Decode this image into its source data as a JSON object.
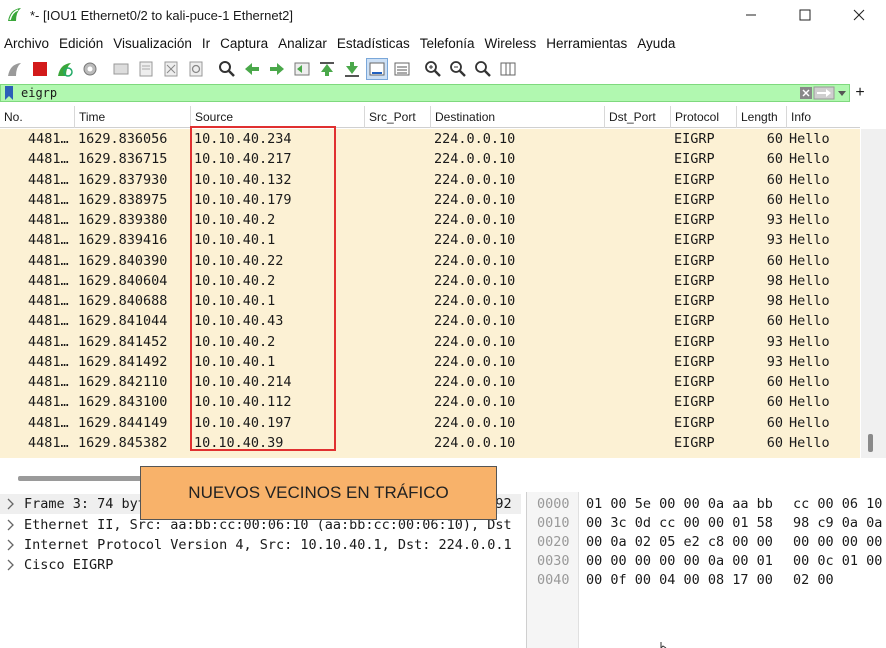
{
  "window": {
    "title": "*- [IOU1 Ethernet0/2 to kali-puce-1 Ethernet2]"
  },
  "menu": [
    "Archivo",
    "Edición",
    "Visualización",
    "Ir",
    "Captura",
    "Analizar",
    "Estadísticas",
    "Telefonía",
    "Wireless",
    "Herramientas",
    "Ayuda"
  ],
  "toolbar_icons": [
    "shark-fin-icon",
    "stop-capture-icon",
    "restart-capture-icon",
    "capture-options-icon",
    "open-file-icon",
    "save-file-icon",
    "close-file-icon",
    "reload-icon",
    "find-packet-icon",
    "go-back-icon",
    "go-forward-icon",
    "go-to-packet-icon",
    "go-first-icon",
    "go-last-icon",
    "autoscroll-icon",
    "colorize-icon",
    "zoom-in-icon",
    "zoom-out-icon",
    "zoom-normal-icon",
    "resize-columns-icon"
  ],
  "filter": {
    "value": "eigrp"
  },
  "columns": [
    "No.",
    "Time",
    "Source",
    "Src_Port",
    "Destination",
    "Dst_Port",
    "Protocol",
    "Length",
    "Info"
  ],
  "rows": [
    {
      "no": "4481…",
      "time": "1629.836056",
      "source": "10.10.40.234",
      "src_port": "",
      "destination": "224.0.0.10",
      "dst_port": "",
      "protocol": "EIGRP",
      "length": "60",
      "info": "Hello"
    },
    {
      "no": "4481…",
      "time": "1629.836715",
      "source": "10.10.40.217",
      "src_port": "",
      "destination": "224.0.0.10",
      "dst_port": "",
      "protocol": "EIGRP",
      "length": "60",
      "info": "Hello"
    },
    {
      "no": "4481…",
      "time": "1629.837930",
      "source": "10.10.40.132",
      "src_port": "",
      "destination": "224.0.0.10",
      "dst_port": "",
      "protocol": "EIGRP",
      "length": "60",
      "info": "Hello"
    },
    {
      "no": "4481…",
      "time": "1629.838975",
      "source": "10.10.40.179",
      "src_port": "",
      "destination": "224.0.0.10",
      "dst_port": "",
      "protocol": "EIGRP",
      "length": "60",
      "info": "Hello"
    },
    {
      "no": "4481…",
      "time": "1629.839380",
      "source": "10.10.40.2",
      "src_port": "",
      "destination": "224.0.0.10",
      "dst_port": "",
      "protocol": "EIGRP",
      "length": "93",
      "info": "Hello"
    },
    {
      "no": "4481…",
      "time": "1629.839416",
      "source": "10.10.40.1",
      "src_port": "",
      "destination": "224.0.0.10",
      "dst_port": "",
      "protocol": "EIGRP",
      "length": "93",
      "info": "Hello"
    },
    {
      "no": "4481…",
      "time": "1629.840390",
      "source": "10.10.40.22",
      "src_port": "",
      "destination": "224.0.0.10",
      "dst_port": "",
      "protocol": "EIGRP",
      "length": "60",
      "info": "Hello"
    },
    {
      "no": "4481…",
      "time": "1629.840604",
      "source": "10.10.40.2",
      "src_port": "",
      "destination": "224.0.0.10",
      "dst_port": "",
      "protocol": "EIGRP",
      "length": "98",
      "info": "Hello"
    },
    {
      "no": "4481…",
      "time": "1629.840688",
      "source": "10.10.40.1",
      "src_port": "",
      "destination": "224.0.0.10",
      "dst_port": "",
      "protocol": "EIGRP",
      "length": "98",
      "info": "Hello"
    },
    {
      "no": "4481…",
      "time": "1629.841044",
      "source": "10.10.40.43",
      "src_port": "",
      "destination": "224.0.0.10",
      "dst_port": "",
      "protocol": "EIGRP",
      "length": "60",
      "info": "Hello"
    },
    {
      "no": "4481…",
      "time": "1629.841452",
      "source": "10.10.40.2",
      "src_port": "",
      "destination": "224.0.0.10",
      "dst_port": "",
      "protocol": "EIGRP",
      "length": "93",
      "info": "Hello"
    },
    {
      "no": "4481…",
      "time": "1629.841492",
      "source": "10.10.40.1",
      "src_port": "",
      "destination": "224.0.0.10",
      "dst_port": "",
      "protocol": "EIGRP",
      "length": "93",
      "info": "Hello"
    },
    {
      "no": "4481…",
      "time": "1629.842110",
      "source": "10.10.40.214",
      "src_port": "",
      "destination": "224.0.0.10",
      "dst_port": "",
      "protocol": "EIGRP",
      "length": "60",
      "info": "Hello"
    },
    {
      "no": "4481…",
      "time": "1629.843100",
      "source": "10.10.40.112",
      "src_port": "",
      "destination": "224.0.0.10",
      "dst_port": "",
      "protocol": "EIGRP",
      "length": "60",
      "info": "Hello"
    },
    {
      "no": "4481…",
      "time": "1629.844149",
      "source": "10.10.40.197",
      "src_port": "",
      "destination": "224.0.0.10",
      "dst_port": "",
      "protocol": "EIGRP",
      "length": "60",
      "info": "Hello"
    },
    {
      "no": "4481…",
      "time": "1629.845382",
      "source": "10.10.40.39",
      "src_port": "",
      "destination": "224.0.0.10",
      "dst_port": "",
      "protocol": "EIGRP",
      "length": "60",
      "info": "Hello"
    }
  ],
  "annotation": "NUEVOS VECINOS EN TRÁFICO",
  "details": [
    "Frame 3: 74 bytes on wire (592 bits), 74 bytes captured (592",
    "Ethernet II, Src: aa:bb:cc:00:06:10 (aa:bb:cc:00:06:10), Dst",
    "Internet Protocol Version 4, Src: 10.10.40.1, Dst: 224.0.0.1",
    "Cisco EIGRP"
  ],
  "bytes": [
    {
      "offset": "0000",
      "hex1": "01 00 5e 00 00 0a aa bb",
      "hex2": "cc 00 06 10"
    },
    {
      "offset": "0010",
      "hex1": "00 3c 0d cc 00 00 01 58",
      "hex2": "98 c9 0a 0a"
    },
    {
      "offset": "0020",
      "hex1": "00 0a 02 05 e2 c8 00 00",
      "hex2": "00 00 00 00"
    },
    {
      "offset": "0030",
      "hex1": "00 00 00 00 00 0a 00 01",
      "hex2": "00 0c 01 00"
    },
    {
      "offset": "0040",
      "hex1": "00 0f 00 04 00 08 17 00",
      "hex2": "02 00"
    }
  ],
  "colors": {
    "row_bg": "#fcf1d4",
    "filter_bg": "#b1f8b0",
    "highlight_box": "#e03030",
    "annotation_bg": "#f8b26a"
  }
}
